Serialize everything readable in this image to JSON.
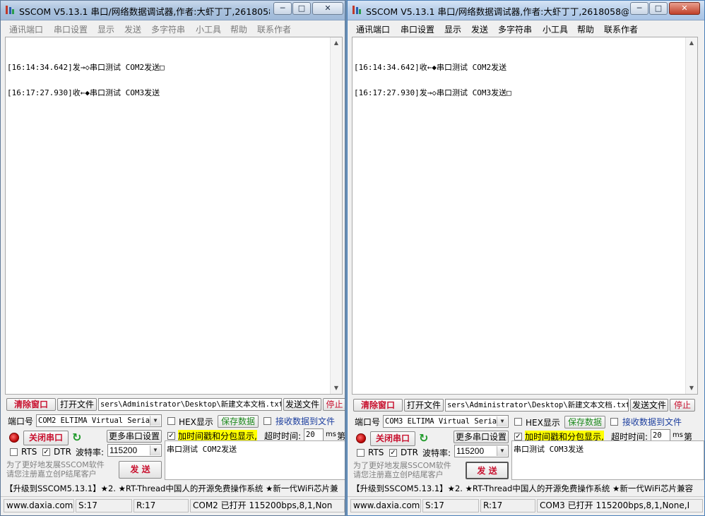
{
  "win1": {
    "title": "SSCOM V5.13.1 串口/网络数据调试器,作者:大虾丁丁,2618058...",
    "controls": {
      "min": "─",
      "max": "□",
      "close": "✕"
    },
    "menu": [
      "通讯端口",
      "串口设置",
      "显示",
      "发送",
      "多字符串",
      "小工具",
      "帮助",
      "联系作者"
    ],
    "log": [
      "[16:14:34.642]发→◇串口测试 COM2发送□",
      "[16:17:27.930]收←◆串口测试 COM3发送"
    ],
    "clear_btn": "清除窗口",
    "open_file_btn": "打开文件",
    "file_path": "sers\\Administrator\\Desktop\\新建文本文档.txt",
    "send_file_btn": "发送文件",
    "stop_btn": "停止",
    "port_label": "端口号",
    "port_value": "COM2 ELTIMA Virtual Serial",
    "hex_label": "HEX显示",
    "save_data_btn": "保存数据",
    "recv_to_file": "接收数据到文件",
    "close_port_btn": "关闭串口",
    "more_settings_btn": "更多串口设置",
    "timestamp_label": "加时间戳和分包显示,",
    "timeout_label": "超时时间:",
    "timeout_value": "20",
    "timeout_unit": "ms",
    "extra": "第",
    "rts_label": "RTS",
    "dtr_label": "DTR",
    "dtr_check": "✓",
    "ts_check": "✓",
    "baud_label": "波特率:",
    "baud_value": "115200",
    "send_text": "串口测试 COM2发送",
    "promo1": "为了更好地发展SSCOM软件",
    "promo2": "请您注册嘉立创P结尾客户",
    "send_btn": "发 送",
    "ticker": "【升级到SSCOM5.13.1】★2. ★RT-Thread中国人的开源免费操作系统 ★新一代WiFi芯片兼",
    "status": {
      "site": "www.daxia.com",
      "s": "S:17",
      "r": "R:17",
      "port": "COM2 已打开  115200bps,8,1,Non"
    }
  },
  "win2": {
    "title": "SSCOM V5.13.1 串口/网络数据调试器,作者:大虾丁丁,2618058@q...",
    "controls": {
      "min": "─",
      "max": "□",
      "close": "✕"
    },
    "menu": [
      "通讯端口",
      "串口设置",
      "显示",
      "发送",
      "多字符串",
      "小工具",
      "帮助",
      "联系作者"
    ],
    "log": [
      "[16:14:34.642]收←◆串口测试 COM2发送",
      "[16:17:27.930]发→◇串口测试 COM3发送□"
    ],
    "clear_btn": "清除窗口",
    "open_file_btn": "打开文件",
    "file_path": "sers\\Administrator\\Desktop\\新建文本文档.txt",
    "send_file_btn": "发送文件",
    "stop_btn": "停止",
    "port_label": "端口号",
    "port_value": "COM3 ELTIMA Virtual Serial",
    "hex_label": "HEX显示",
    "save_data_btn": "保存数据",
    "recv_to_file": "接收数据到文件",
    "close_port_btn": "关闭串口",
    "more_settings_btn": "更多串口设置",
    "timestamp_label": "加时间戳和分包显示,",
    "timeout_label": "超时时间:",
    "timeout_value": "20",
    "timeout_unit": "ms",
    "extra": "第",
    "rts_label": "RTS",
    "dtr_label": "DTR",
    "dtr_check": "✓",
    "ts_check": "✓",
    "baud_label": "波特率:",
    "baud_value": "115200",
    "send_text": "串口测试 COM3发送",
    "promo1": "为了更好地发展SSCOM软件",
    "promo2": "请您注册嘉立创P结尾客户",
    "send_btn": "发 送",
    "ticker": "【升级到SSCOM5.13.1】★2. ★RT-Thread中国人的开源免费操作系统 ★新一代WiFi芯片兼容",
    "status": {
      "site": "www.daxia.com",
      "s": "S:17",
      "r": "R:17",
      "port": "COM3 已打开  115200bps,8,1,None,I"
    }
  }
}
